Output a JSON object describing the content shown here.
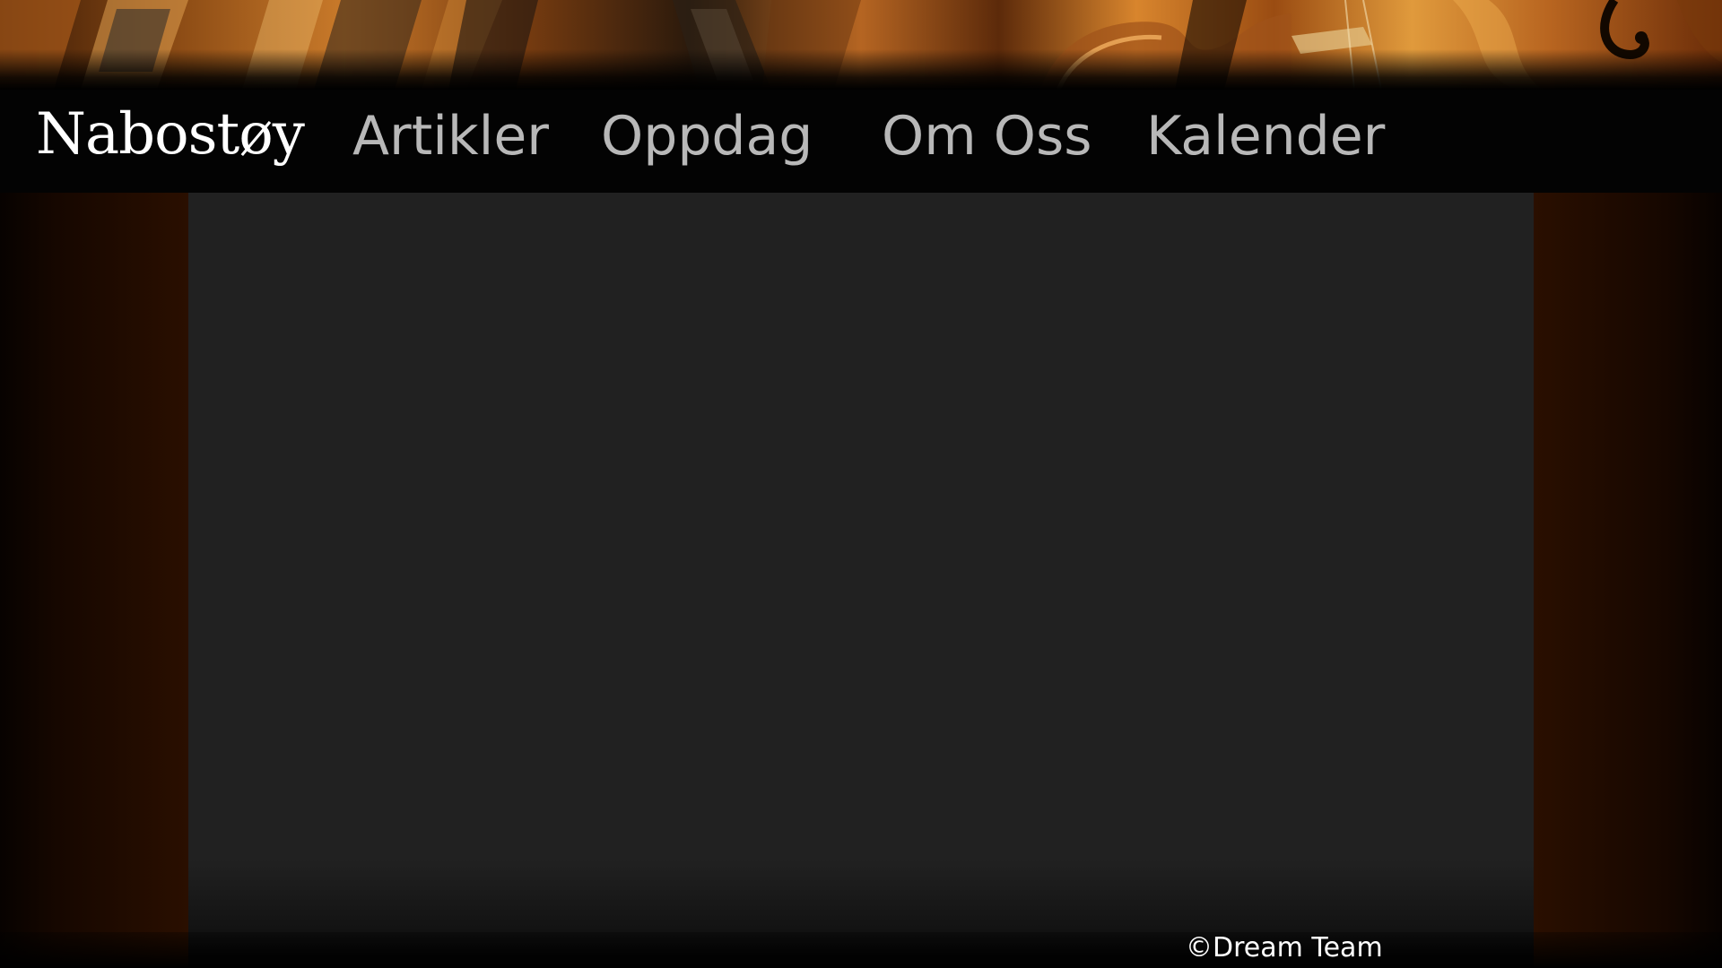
{
  "header": {
    "banner_image": "instrument-banner",
    "brand": "Nabostøy"
  },
  "nav": {
    "items": [
      {
        "label": "Artikler"
      },
      {
        "label": "Oppdag"
      },
      {
        "label": "Om Oss"
      },
      {
        "label": "Kalender"
      }
    ]
  },
  "footer": {
    "copyright": "©Dream Team"
  },
  "colors": {
    "nav_background": "#030303",
    "brand_text": "#ffffff",
    "nav_text": "#b8b8b8",
    "content_background": "#212121",
    "side_panel": "#2a0f00"
  }
}
